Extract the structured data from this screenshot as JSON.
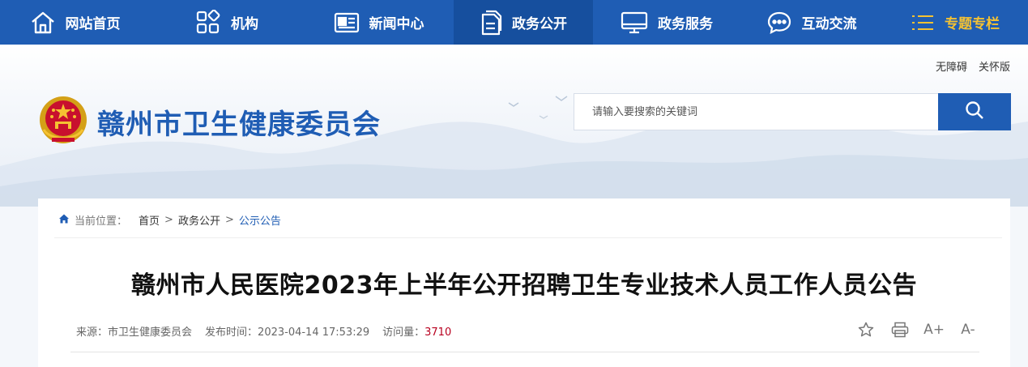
{
  "nav": {
    "items": [
      {
        "label": "网站首页",
        "icon": "home-icon"
      },
      {
        "label": "机构",
        "icon": "grid-icon"
      },
      {
        "label": "新闻中心",
        "icon": "news-icon"
      },
      {
        "label": "政务公开",
        "icon": "document-icon",
        "active": true
      },
      {
        "label": "政务服务",
        "icon": "monitor-icon"
      },
      {
        "label": "互动交流",
        "icon": "chat-icon"
      },
      {
        "label": "专题专栏",
        "icon": "list-icon"
      }
    ]
  },
  "header": {
    "access_links": [
      "无障碍",
      "关怀版"
    ],
    "site_title": "赣州市卫生健康委员会",
    "search_placeholder": "请输入要搜索的关键词"
  },
  "breadcrumb": {
    "prefix": "当前位置：",
    "items": [
      "首页",
      "政务公开",
      "公示公告"
    ]
  },
  "article": {
    "title": "赣州市人民医院2023年上半年公开招聘卫生专业技术人员工作人员公告",
    "source_label": "来源：",
    "source": "市卫生健康委员会",
    "time_label": "发布时间：",
    "time": "2023-04-14 17:53:29",
    "views_label": "访问量：",
    "views": "3710"
  },
  "tools": {
    "font_increase": "A+",
    "font_decrease": "A-"
  },
  "colors": {
    "nav_bg": "#1f5db4",
    "nav_active": "#164f9e",
    "special": "#f5c232",
    "title_blue": "#1f5db4",
    "views_red": "#b8001f"
  }
}
